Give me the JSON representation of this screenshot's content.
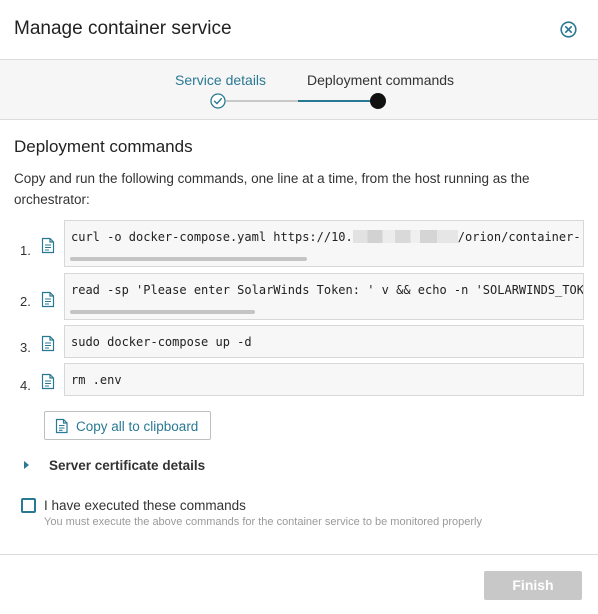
{
  "dialog": {
    "title": "Manage container service",
    "close_icon": "close-circle-icon"
  },
  "wizard": {
    "steps": [
      {
        "label": "Service details",
        "state": "completed",
        "icon": "check-circle-icon"
      },
      {
        "label": "Deployment commands",
        "state": "active",
        "icon": "filled-dot-icon"
      }
    ]
  },
  "section": {
    "title": "Deployment commands",
    "intro": "Copy and run the following commands, one line at a time, from the host running as the orchestrator:"
  },
  "commands": [
    {
      "number": "1.",
      "prefix": "curl -o docker-compose.yaml https://10.",
      "suffix": "/orion/container-",
      "redacted": true,
      "copy_icon": "copy-document-icon"
    },
    {
      "number": "2.",
      "text": "read -sp 'Please enter SolarWinds Token: ' v && echo -n 'SOLARWINDS_TOKE",
      "copy_icon": "copy-document-icon"
    },
    {
      "number": "3.",
      "text": "sudo docker-compose up -d",
      "copy_icon": "copy-document-icon"
    },
    {
      "number": "4.",
      "text": "rm .env",
      "copy_icon": "copy-document-icon"
    }
  ],
  "copy_all": {
    "label": "Copy all to clipboard",
    "icon": "copy-document-icon"
  },
  "certificate": {
    "label": "Server certificate details",
    "icon": "caret-right-icon",
    "expanded": false
  },
  "confirm": {
    "label": "I have executed these commands",
    "hint": "You must execute the above commands for the container service to be monitored properly",
    "checked": false
  },
  "footer": {
    "finish_label": "Finish",
    "finish_enabled": false
  },
  "colors": {
    "accent": "#297994",
    "disabled_button": "#c8c8c8",
    "code_background": "#f7f7f7"
  }
}
